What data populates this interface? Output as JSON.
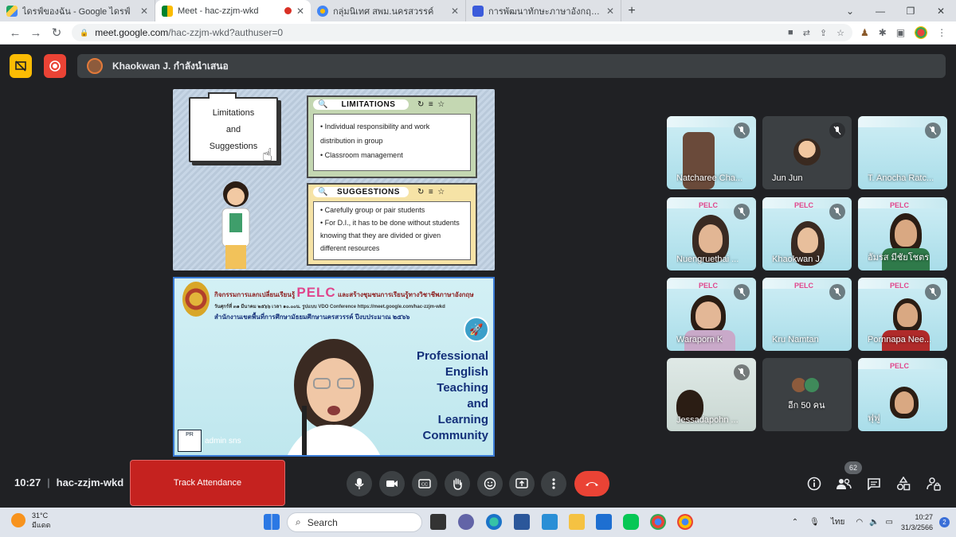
{
  "browser": {
    "tabs": [
      {
        "title": "ไดรฟ์ของฉัน - Google ไดรฟ์",
        "favicon_color": "#1fa463"
      },
      {
        "title": "Meet - hac-zzjm-wkd",
        "favicon_color": "#00832d"
      },
      {
        "title": "กลุ่มนิเทศ สพม.นครสวรรค์",
        "favicon_color": "#4285f4"
      },
      {
        "title": "การพัฒนาทักษะภาษาอังกฤษ English",
        "favicon_color": "#3b5bdb"
      }
    ],
    "url_host": "meet.google.com",
    "url_path": "/hac-zzjm-wkd?authuser=0"
  },
  "meet": {
    "presenter_text": "Khaokwan J. กำลังนำเสนอ",
    "meeting_code": "hac-zzjm-wkd",
    "time": "10:27",
    "track_attendance_label": "Track Attendance",
    "participant_count": "62",
    "participants": [
      {
        "name": "Natcharee Cha..."
      },
      {
        "name": "Jun Jun"
      },
      {
        "name": "T. Anocha Ratc..."
      },
      {
        "name": "Nuengruethai ..."
      },
      {
        "name": "Khaokwan J."
      },
      {
        "name": "อัมรส มีชัยโชตร"
      },
      {
        "name": "Waraporn K"
      },
      {
        "name": "Kru Namtan"
      },
      {
        "name": "Pornnapa Nee..."
      },
      {
        "name": "Jessadapohn ..."
      },
      {
        "name": "อีก 50 คน"
      },
      {
        "name": "ฟุฟู"
      }
    ]
  },
  "slide": {
    "folder_lines": [
      "Limitations",
      "and",
      "Suggestions"
    ],
    "limitations_title": "LIMITATIONS",
    "limitations_items": [
      "Individual responsibility and work distribution in group",
      "Classroom management"
    ],
    "suggestions_title": "SUGGESTIONS",
    "suggestions_items": [
      "Carefully group or pair students",
      "For D.I., it has to be done without students knowing that they are divided or given different resources"
    ],
    "banner_line1_pre": "กิจกรรมการแลกเปลี่ยนเรียนรู้",
    "banner_pelc": "PELC",
    "banner_line1_post": "และสร้างชุมชนการเรียนรู้ทางวิชาชีพภาษาอังกฤษ",
    "banner_line2": "วันศุกร์ที่ ๓๑ มีนาคม ๒๕๖๖ เวลา ๑๐.๐๐น. รูปแบบ VDO Conference https://meet.google.com/hac-zzjm-wkd",
    "banner_line3": "สำนักงานเขตพื้นที่การศึกษามัธยมศึกษานครสวรรค์ ปีงบประมาณ ๒๕๖๖",
    "community_lines": [
      "Professional",
      "English",
      "Teaching",
      "and",
      "Learning",
      "Community"
    ],
    "speaker_label": "admin sns",
    "logo_text": "PR"
  },
  "taskbar": {
    "temp": "31°C",
    "weather": "มีแดด",
    "search": "Search",
    "language": "ไทย",
    "clock_time": "10:27",
    "clock_date": "31/3/2566",
    "notifications": "2"
  }
}
